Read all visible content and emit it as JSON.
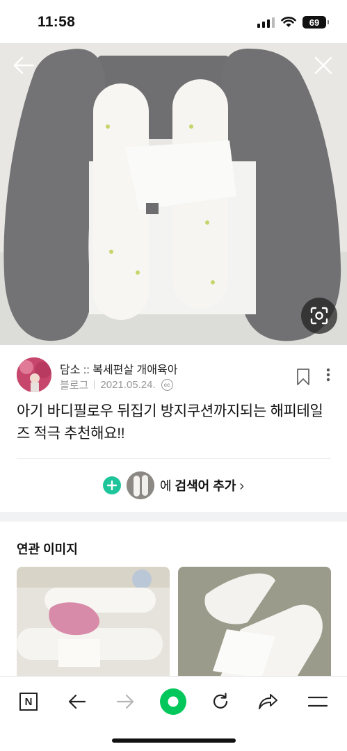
{
  "status": {
    "time": "11:58",
    "battery": "69"
  },
  "hero": {
    "back_icon": "arrow-left-icon",
    "close_icon": "close-icon",
    "lens_icon": "image-search-lens-icon"
  },
  "post": {
    "author": "담소 :: 복세편살 개애육아",
    "category": "블로그",
    "date": "2021.05.24.",
    "license_icon": "creative-commons-icon",
    "title": "아기 바디필로우 뒤집기 방지쿠션까지되는 해피테일즈 적극 추천해요!!"
  },
  "add_search": {
    "prefix": "에 ",
    "bold": "검색어 추가",
    "chevron": "›"
  },
  "related": {
    "title": "연관 이미지"
  },
  "bottom_nav": {
    "n_label": "N",
    "icons": [
      "naver-n-icon",
      "back-arrow-icon",
      "forward-arrow-icon",
      "green-dot-home-icon",
      "refresh-icon",
      "share-icon",
      "menu-icon"
    ]
  },
  "colors": {
    "accent_green": "#03c75a",
    "plus_green": "#1ec59a"
  }
}
